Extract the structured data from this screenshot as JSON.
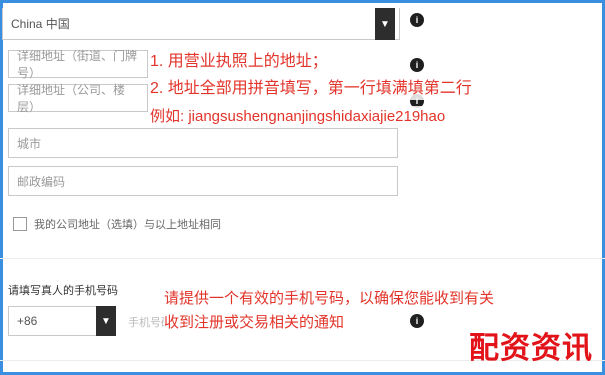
{
  "form": {
    "country_value": "China 中国",
    "address_line1_placeholder": "详细地址（街道、门牌号）",
    "address_line2_placeholder": "详细地址（公司、楼层）",
    "city_placeholder": "城市",
    "postal_placeholder": "邮政编码",
    "same_address_label": "我的公司地址（选填）与以上地址相同",
    "phone_label": "请填写真人的手机号码",
    "phone_prefix": "+86",
    "phone_placeholder": "手机号码"
  },
  "annotations": {
    "line1": "1. 用营业执照上的地址；",
    "line2": "2. 地址全部用拼音填写，第一行填满填第二行",
    "line3": "例如: jiangsushengnanjingshidaxiajie219hao",
    "phone_note_1": "请提供一个有效的手机号码，以确保您能收到有关",
    "phone_note_2": "收到注册或交易相关的通知"
  },
  "watermark": "配资资讯",
  "colors": {
    "annotation": "#e2342a",
    "frame": "#3b8fe0",
    "watermark": "#e2141a"
  }
}
